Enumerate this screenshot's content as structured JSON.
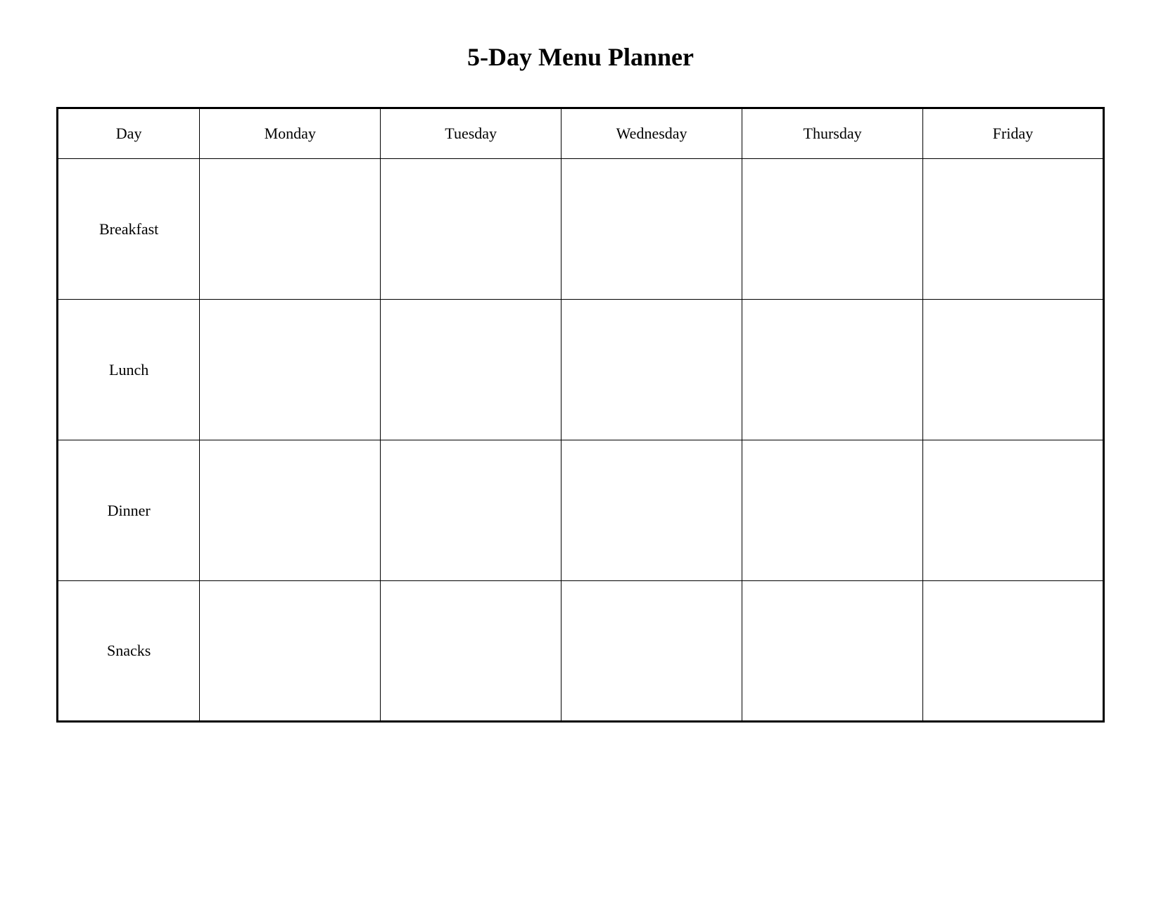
{
  "title": "5-Day Menu Planner",
  "header": {
    "day_label": "Day",
    "days": [
      "Monday",
      "Tuesday",
      "Wednesday",
      "Thursday",
      "Friday"
    ]
  },
  "rows": [
    {
      "meal": "Breakfast"
    },
    {
      "meal": "Lunch"
    },
    {
      "meal": "Dinner"
    },
    {
      "meal": "Snacks"
    }
  ]
}
